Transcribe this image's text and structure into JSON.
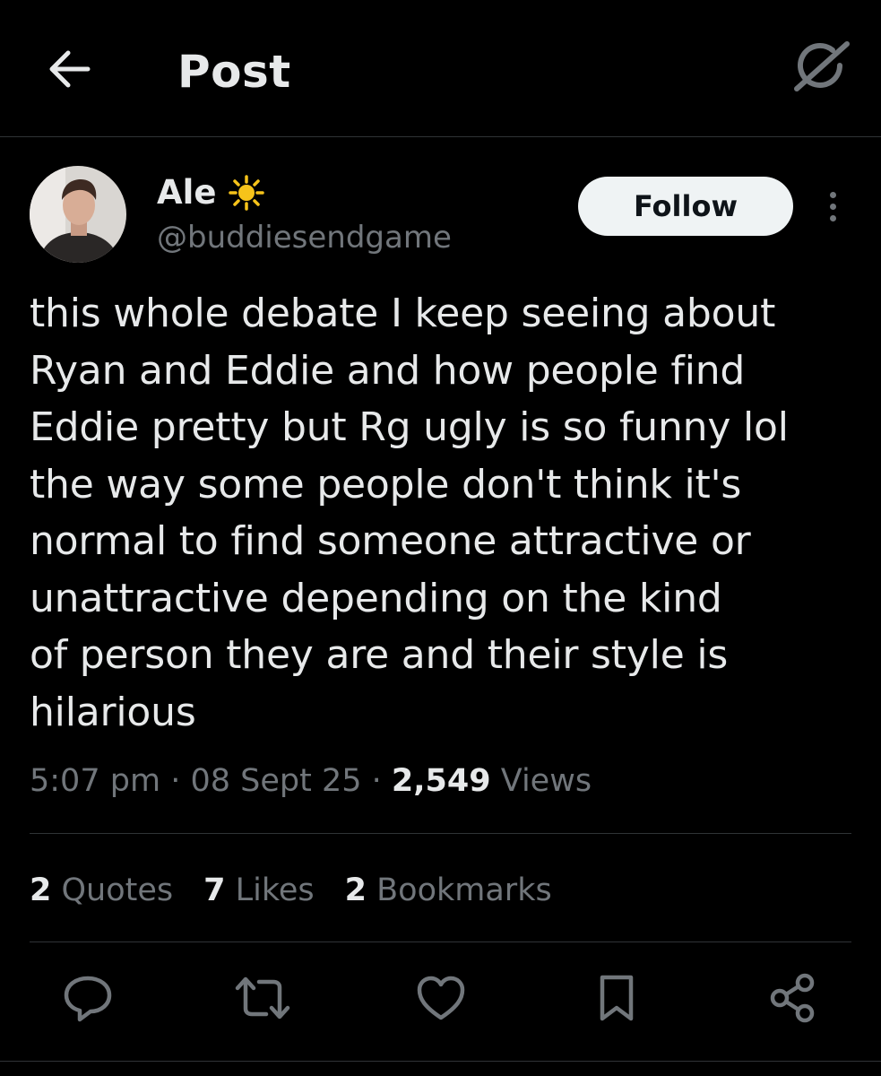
{
  "header": {
    "title": "Post"
  },
  "author": {
    "display_name": "Ale",
    "name_emoji": "sun-emoji",
    "handle": "@buddiesendgame",
    "follow_label": "Follow"
  },
  "post": {
    "text": "this whole debate I keep seeing about\nRyan and Eddie and how people find\nEddie pretty but Rg ugly is so funny lol\nthe way some people don't think it's\nnormal to find someone attractive or\nunattractive depending on the kind\nof person they are and their style is\nhilarious"
  },
  "meta": {
    "time": "5:07 pm",
    "separator": "·",
    "date": "08 Sept 25",
    "views_count": "2,549",
    "views_label": "Views"
  },
  "stats": [
    {
      "count": "2",
      "label": "Quotes"
    },
    {
      "count": "7",
      "label": "Likes"
    },
    {
      "count": "2",
      "label": "Bookmarks"
    }
  ],
  "actions": [
    "reply-icon",
    "repost-icon",
    "like-icon",
    "bookmark-icon",
    "share-icon"
  ],
  "colors": {
    "background": "#000000",
    "text_primary": "#e7e9ea",
    "text_secondary": "#71767b",
    "divider": "#2f3336",
    "follow_bg": "#eff3f4",
    "sun_emoji": "#f6c31a"
  }
}
